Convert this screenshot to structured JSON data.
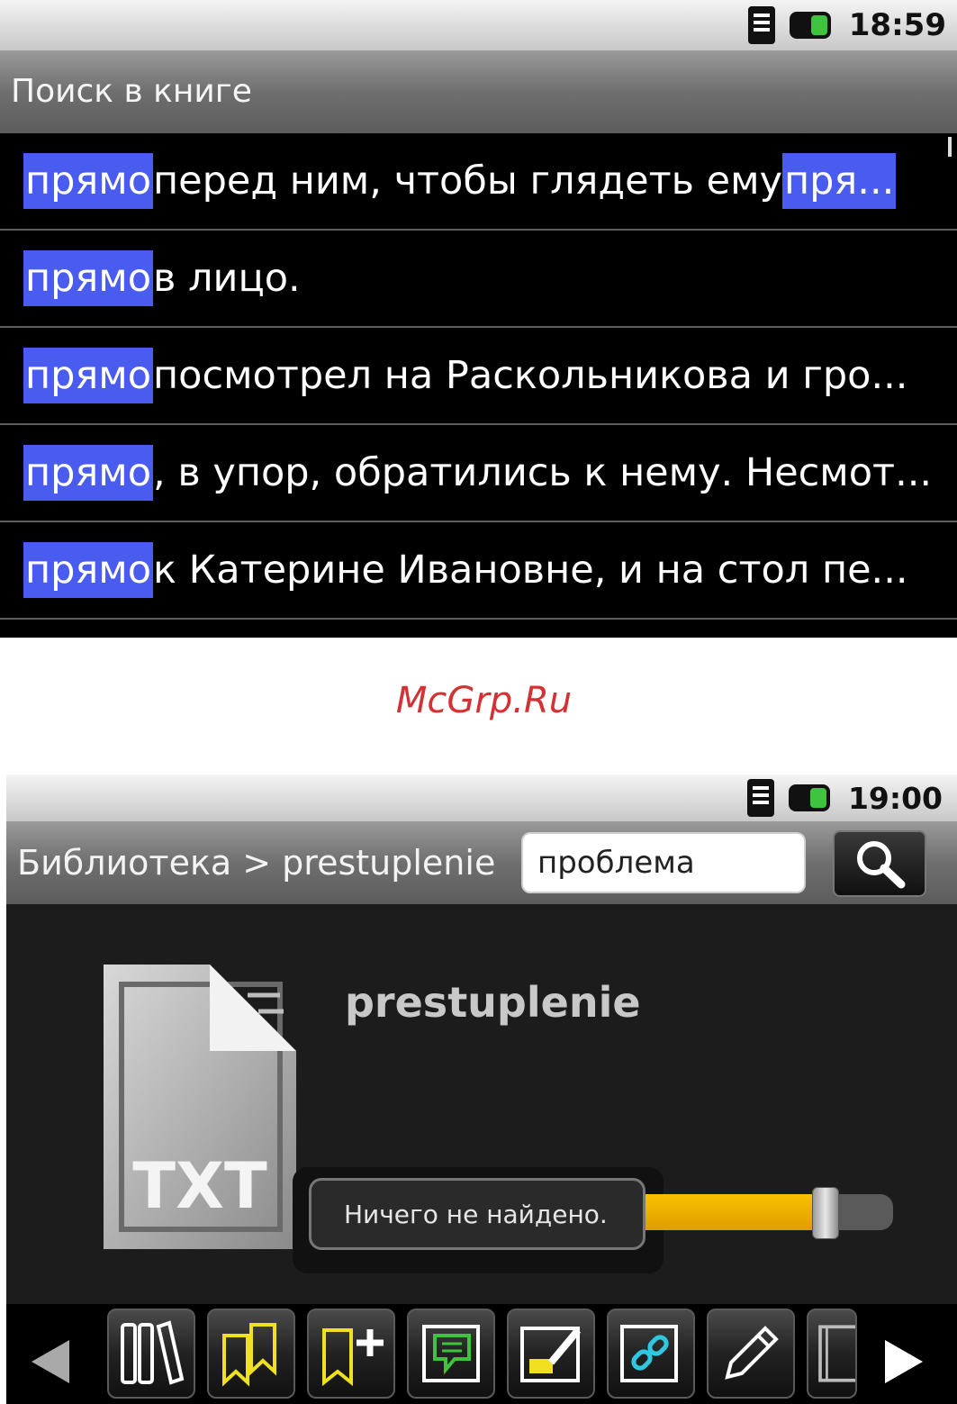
{
  "screen1": {
    "status": {
      "time": "18:59"
    },
    "title": "Поиск в книге",
    "results": [
      {
        "match": "прямо",
        "rest": " перед ним, чтобы глядеть ему ",
        "match2": "пря..."
      },
      {
        "match": "прямо",
        "rest": " в лицо."
      },
      {
        "match": "прямо",
        "rest": " посмотрел на Раскольникова и гро..."
      },
      {
        "match": "прямо",
        "rest": ", в упор, обратились к нему. Несмот..."
      },
      {
        "match": "прямо",
        "rest": " к Катерине Ивановне, и на стол пе..."
      }
    ]
  },
  "watermark": "McGrp.Ru",
  "screen2": {
    "status": {
      "time": "19:00"
    },
    "breadcrumb": "Библиотека > prestuplenie",
    "search": {
      "value": "проблема"
    },
    "book": {
      "title": "prestuplenie",
      "format_label": "TXT"
    },
    "toast": "Ничего не найдено.",
    "progress_fraction": 0.72,
    "toolbar": {
      "icons": [
        "library-icon",
        "bookmarks-icon",
        "add-bookmark-icon",
        "note-icon",
        "highlight-icon",
        "link-icon",
        "pencil-icon",
        "book-info-icon"
      ]
    },
    "colors": {
      "highlight": "#4a5cf0",
      "progress": "#f7c200",
      "accent_yellow": "#f0e020",
      "accent_green": "#3ec43e",
      "accent_cyan": "#2fc8e0"
    }
  }
}
